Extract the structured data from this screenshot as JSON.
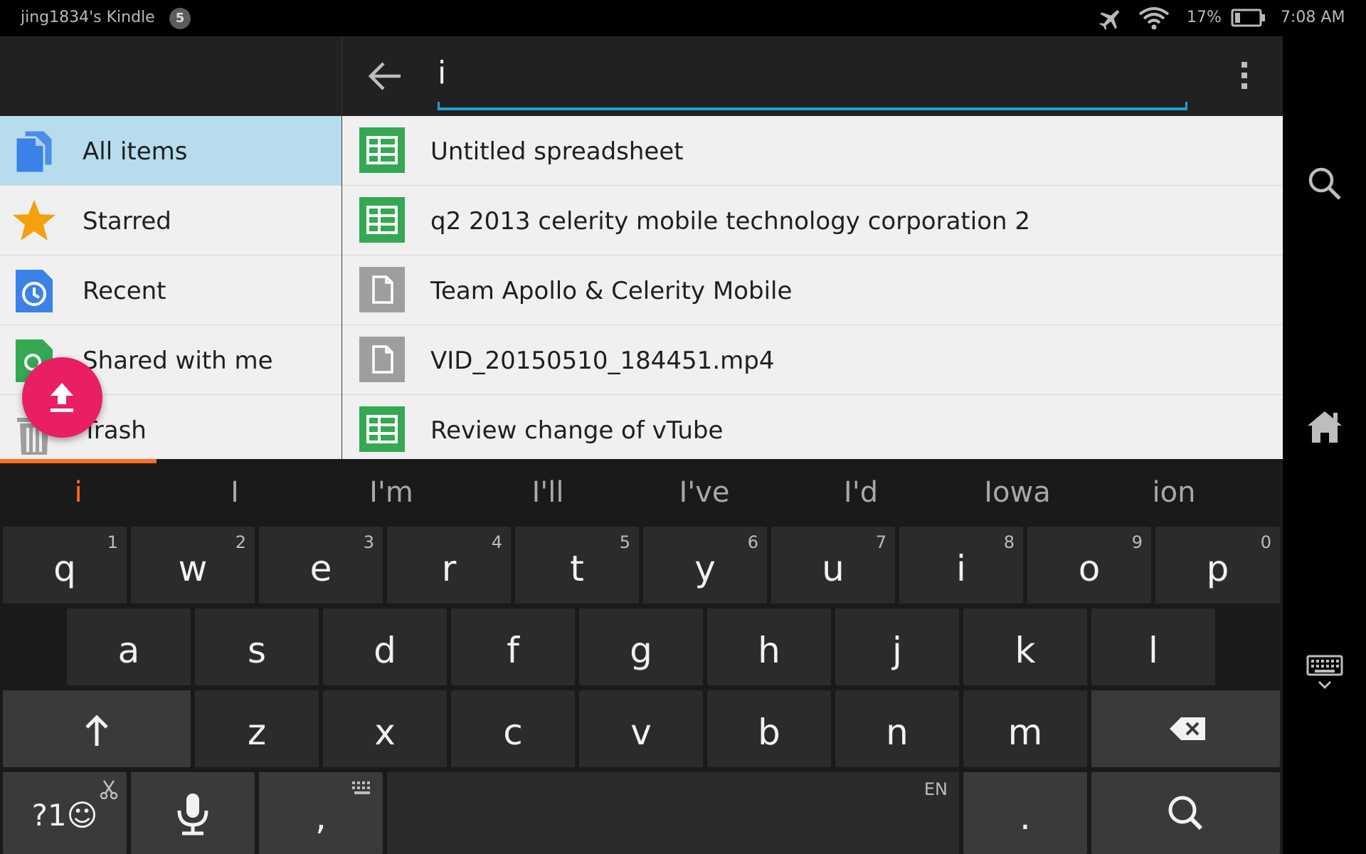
{
  "status_bar": {
    "device_name": "jing1834's Kindle",
    "notification_count": "5",
    "battery_percent": "17%",
    "time": "7:08 AM"
  },
  "app_bar": {
    "search_value": "i"
  },
  "sidebar": {
    "items": [
      {
        "label": "All items",
        "icon": "all-items-icon",
        "active": true
      },
      {
        "label": "Starred",
        "icon": "star-icon"
      },
      {
        "label": "Recent",
        "icon": "clock-icon"
      },
      {
        "label": "Shared with me",
        "icon": "shared-icon"
      },
      {
        "label": "Trash",
        "icon": "trash-icon"
      }
    ]
  },
  "files": [
    {
      "name": "Untitled spreadsheet",
      "type": "spreadsheet"
    },
    {
      "name": "q2 2013 celerity mobile technology corporation 2",
      "type": "spreadsheet"
    },
    {
      "name": "Team Apollo & Celerity Mobile",
      "type": "file"
    },
    {
      "name": "VID_20150510_184451.mp4",
      "type": "file"
    },
    {
      "name": "Review change of vTube",
      "type": "spreadsheet"
    }
  ],
  "keyboard": {
    "suggestions": [
      "i",
      "I",
      "I'm",
      "I'll",
      "I've",
      "I'd",
      "Iowa",
      "ion"
    ],
    "row1": [
      {
        "k": "q",
        "n": "1"
      },
      {
        "k": "w",
        "n": "2"
      },
      {
        "k": "e",
        "n": "3"
      },
      {
        "k": "r",
        "n": "4"
      },
      {
        "k": "t",
        "n": "5"
      },
      {
        "k": "y",
        "n": "6"
      },
      {
        "k": "u",
        "n": "7"
      },
      {
        "k": "i",
        "n": "8"
      },
      {
        "k": "o",
        "n": "9"
      },
      {
        "k": "p",
        "n": "0"
      }
    ],
    "row2": [
      "a",
      "s",
      "d",
      "f",
      "g",
      "h",
      "j",
      "k",
      "l"
    ],
    "row3": [
      "z",
      "x",
      "c",
      "v",
      "b",
      "n",
      "m"
    ],
    "symbols_label": "?1☺",
    "comma": ",",
    "period": ".",
    "language": "EN"
  },
  "colors": {
    "accent_blue": "#1ea0d6",
    "fab_pink": "#e91e63",
    "suggest_orange": "#ff6d1f",
    "sheet_green": "#34a853",
    "active_row": "#b7dcee"
  }
}
